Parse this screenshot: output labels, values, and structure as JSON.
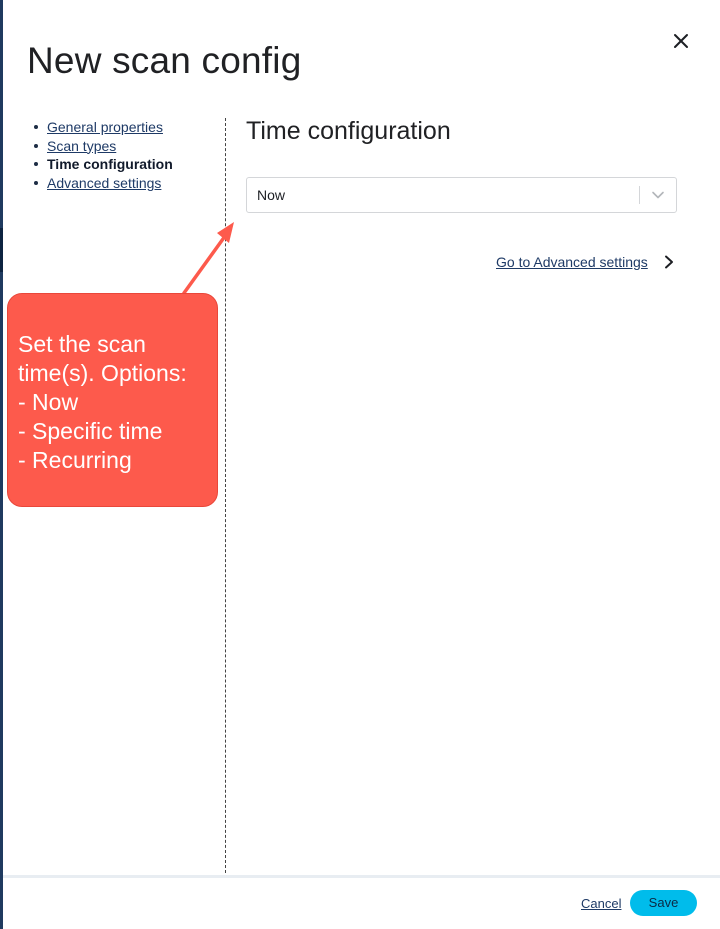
{
  "panel": {
    "title": "New scan config",
    "close_icon": "close-icon"
  },
  "nav": {
    "items": [
      {
        "label": "General properties",
        "active": false
      },
      {
        "label": "Scan types",
        "active": false
      },
      {
        "label": "Time configuration",
        "active": true
      },
      {
        "label": "Advanced settings",
        "active": false
      }
    ]
  },
  "main": {
    "section_title": "Time configuration",
    "time_select": {
      "value": "Now",
      "icon": "chevron-down-icon"
    },
    "advanced_link": {
      "label": "Go to Advanced settings",
      "icon": "chevron-right-icon"
    }
  },
  "annotation": {
    "lines": [
      "Set the scan",
      "time(s). Options:",
      "- Now",
      "- Specific time",
      "- Recurring"
    ],
    "color": "#fd5a4c"
  },
  "footer": {
    "cancel_label": "Cancel",
    "save_label": "Save"
  },
  "colors": {
    "link": "#1e3a66",
    "primary_button": "#00bceb",
    "sidebar_edge": "#1f3a5f"
  }
}
